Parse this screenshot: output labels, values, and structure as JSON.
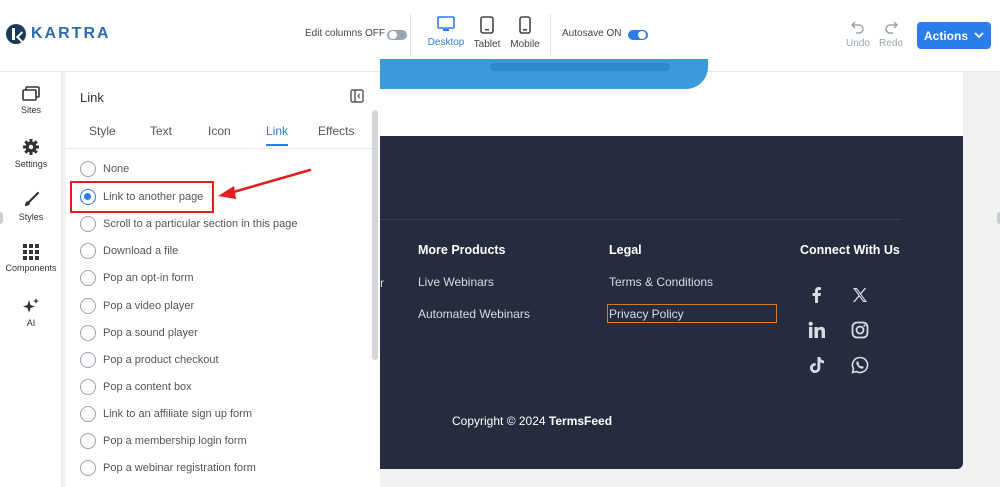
{
  "topbar": {
    "logo_text": "KARTRA",
    "edit_columns_label": "Edit columns OFF",
    "devices": [
      {
        "label": "Desktop",
        "active": true
      },
      {
        "label": "Tablet",
        "active": false
      },
      {
        "label": "Mobile",
        "active": false
      }
    ],
    "autosave_label": "Autosave ON",
    "undo_label": "Undo",
    "redo_label": "Redo",
    "actions_label": "Actions"
  },
  "rail": {
    "items": [
      {
        "label": "Sites",
        "icon": "sites-icon"
      },
      {
        "label": "Settings",
        "icon": "gear-icon"
      },
      {
        "label": "Styles",
        "icon": "brush-icon"
      },
      {
        "label": "Components",
        "icon": "grid-icon"
      },
      {
        "label": "AI",
        "icon": "sparkle-icon"
      }
    ]
  },
  "panel": {
    "title": "Link",
    "tabs": [
      "Style",
      "Text",
      "Icon",
      "Link",
      "Effects"
    ],
    "active_tab": "Link",
    "options": [
      "None",
      "Link to another page",
      "Scroll to a particular section in this page",
      "Download a file",
      "Pop an opt-in form",
      "Pop a video player",
      "Pop a sound player",
      "Pop a product checkout",
      "Pop a content box",
      "Link to an affiliate sign up form",
      "Pop a membership login form",
      "Pop a webinar registration form"
    ],
    "selected_option": "Link to another page"
  },
  "footer": {
    "edge_char": "r",
    "columns": [
      {
        "heading": "More Products",
        "links": [
          "Live Webinars",
          "Automated Webinars"
        ]
      },
      {
        "heading": "Legal",
        "links": [
          "Terms & Conditions",
          "Privacy Policy"
        ]
      },
      {
        "heading": "Connect With Us",
        "links": []
      }
    ],
    "social_icons": [
      "facebook-icon",
      "x-icon",
      "linkedin-icon",
      "instagram-icon",
      "tiktok-icon",
      "whatsapp-icon"
    ],
    "copyright_prefix": "Copyright © 2024 ",
    "copyright_brand": "TermsFeed"
  },
  "colors": {
    "accent": "#2b7de9",
    "footer_bg": "#262c3e",
    "highlight": "#e51d1d",
    "selected_link_outline": "#d77a2e"
  }
}
